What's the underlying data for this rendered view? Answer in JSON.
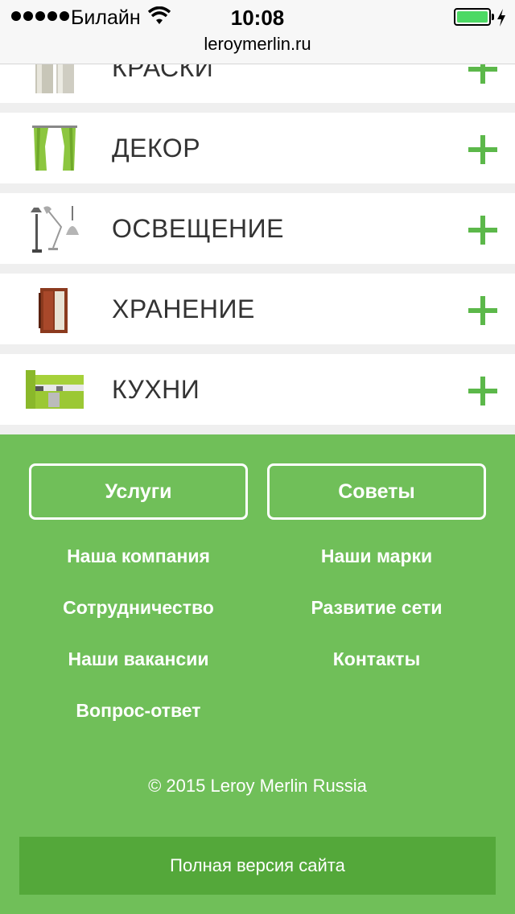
{
  "status_bar": {
    "carrier": "Билайн",
    "time": "10:08",
    "url": "leroymerlin.ru",
    "battery_level": 1.0
  },
  "categories": [
    {
      "label": "КРАСКИ",
      "icon": "paint-cans-icon"
    },
    {
      "label": "ДЕКОР",
      "icon": "curtains-icon"
    },
    {
      "label": "ОСВЕЩЕНИЕ",
      "icon": "lamps-icon"
    },
    {
      "label": "ХРАНЕНИЕ",
      "icon": "wardrobe-icon"
    },
    {
      "label": "КУХНИ",
      "icon": "kitchen-icon"
    }
  ],
  "footer": {
    "buttons": {
      "services": "Услуги",
      "advice": "Советы"
    },
    "links": {
      "company": "Наша компания",
      "brands": "Наши марки",
      "cooperation": "Сотрудничество",
      "network": "Развитие сети",
      "vacancies": "Наши вакансии",
      "contacts": "Контакты",
      "faq": "Вопрос-ответ"
    },
    "copyright": "© 2015 Leroy Merlin Russia",
    "full_version": "Полная версия сайта"
  },
  "colors": {
    "accent_green": "#70bf59",
    "dark_green": "#54a83a",
    "plus_green": "#5cb84a"
  }
}
